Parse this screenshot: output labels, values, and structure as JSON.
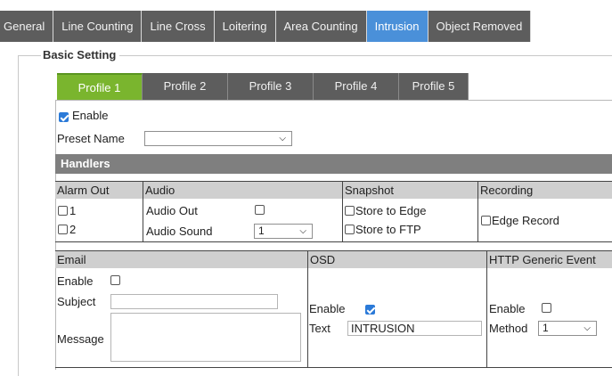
{
  "tabs": [
    {
      "label": "General"
    },
    {
      "label": "Line Counting"
    },
    {
      "label": "Line Cross"
    },
    {
      "label": "Loitering"
    },
    {
      "label": "Area Counting"
    },
    {
      "label": "Intrusion"
    },
    {
      "label": "Object Removed"
    }
  ],
  "basic_setting": {
    "title": "Basic Setting",
    "profiles": [
      "Profile 1",
      "Profile 2",
      "Profile 3",
      "Profile 4",
      "Profile 5"
    ],
    "enable_label": "Enable",
    "preset_name_label": "Preset Name",
    "preset_name_value": ""
  },
  "handlers": {
    "title": "Handlers",
    "alarm_out": {
      "header": "Alarm Out",
      "opt1": "1",
      "opt2": "2"
    },
    "audio": {
      "header": "Audio",
      "audio_out_label": "Audio Out",
      "audio_sound_label": "Audio Sound",
      "audio_sound_value": "1"
    },
    "snapshot": {
      "header": "Snapshot",
      "store_edge": "Store to Edge",
      "store_ftp": "Store to FTP"
    },
    "recording": {
      "header": "Recording",
      "edge_record": "Edge Record"
    },
    "email": {
      "header": "Email",
      "enable_label": "Enable",
      "subject_label": "Subject",
      "message_label": "Message",
      "subject_value": "",
      "message_value": ""
    },
    "osd": {
      "header": "OSD",
      "enable_label": "Enable",
      "text_label": "Text",
      "text_value": "INTRUSION"
    },
    "http": {
      "header": "HTTP Generic Event",
      "enable_label": "Enable",
      "method_label": "Method",
      "method_value": "1"
    }
  }
}
